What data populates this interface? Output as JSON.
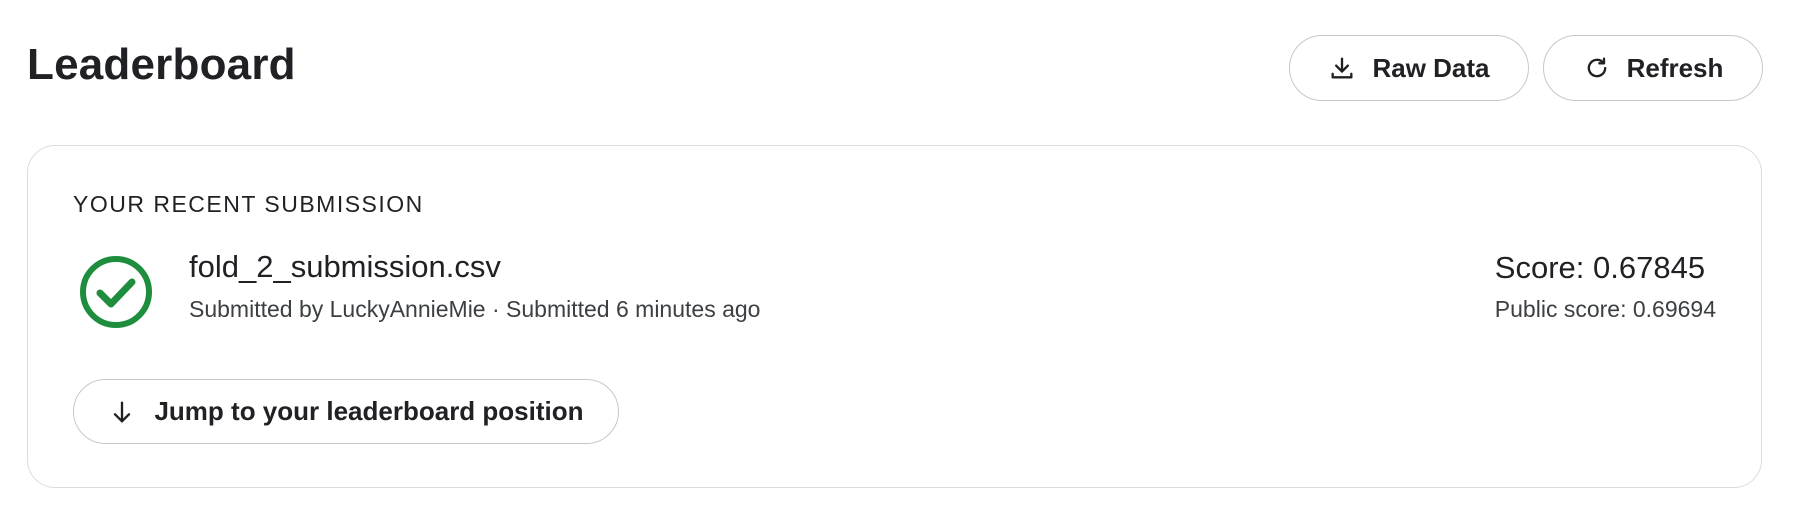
{
  "header": {
    "title": "Leaderboard",
    "raw_data_label": "Raw Data",
    "refresh_label": "Refresh"
  },
  "submission": {
    "section_label": "YOUR RECENT SUBMISSION",
    "file_name": "fold_2_submission.csv",
    "meta": "Submitted by LuckyAnnieMie · Submitted 6 minutes ago",
    "score": "Score: 0.67845",
    "public_score": "Public score: 0.69694",
    "jump_label": "Jump to your leaderboard position",
    "status": "success"
  },
  "icons": {
    "raw_data": "download-icon",
    "refresh": "refresh-icon",
    "status": "check-circle-icon",
    "jump": "arrow-down-icon"
  },
  "colors": {
    "success": "#1e8e3e",
    "border": "#dadce0",
    "text": "#202124"
  }
}
